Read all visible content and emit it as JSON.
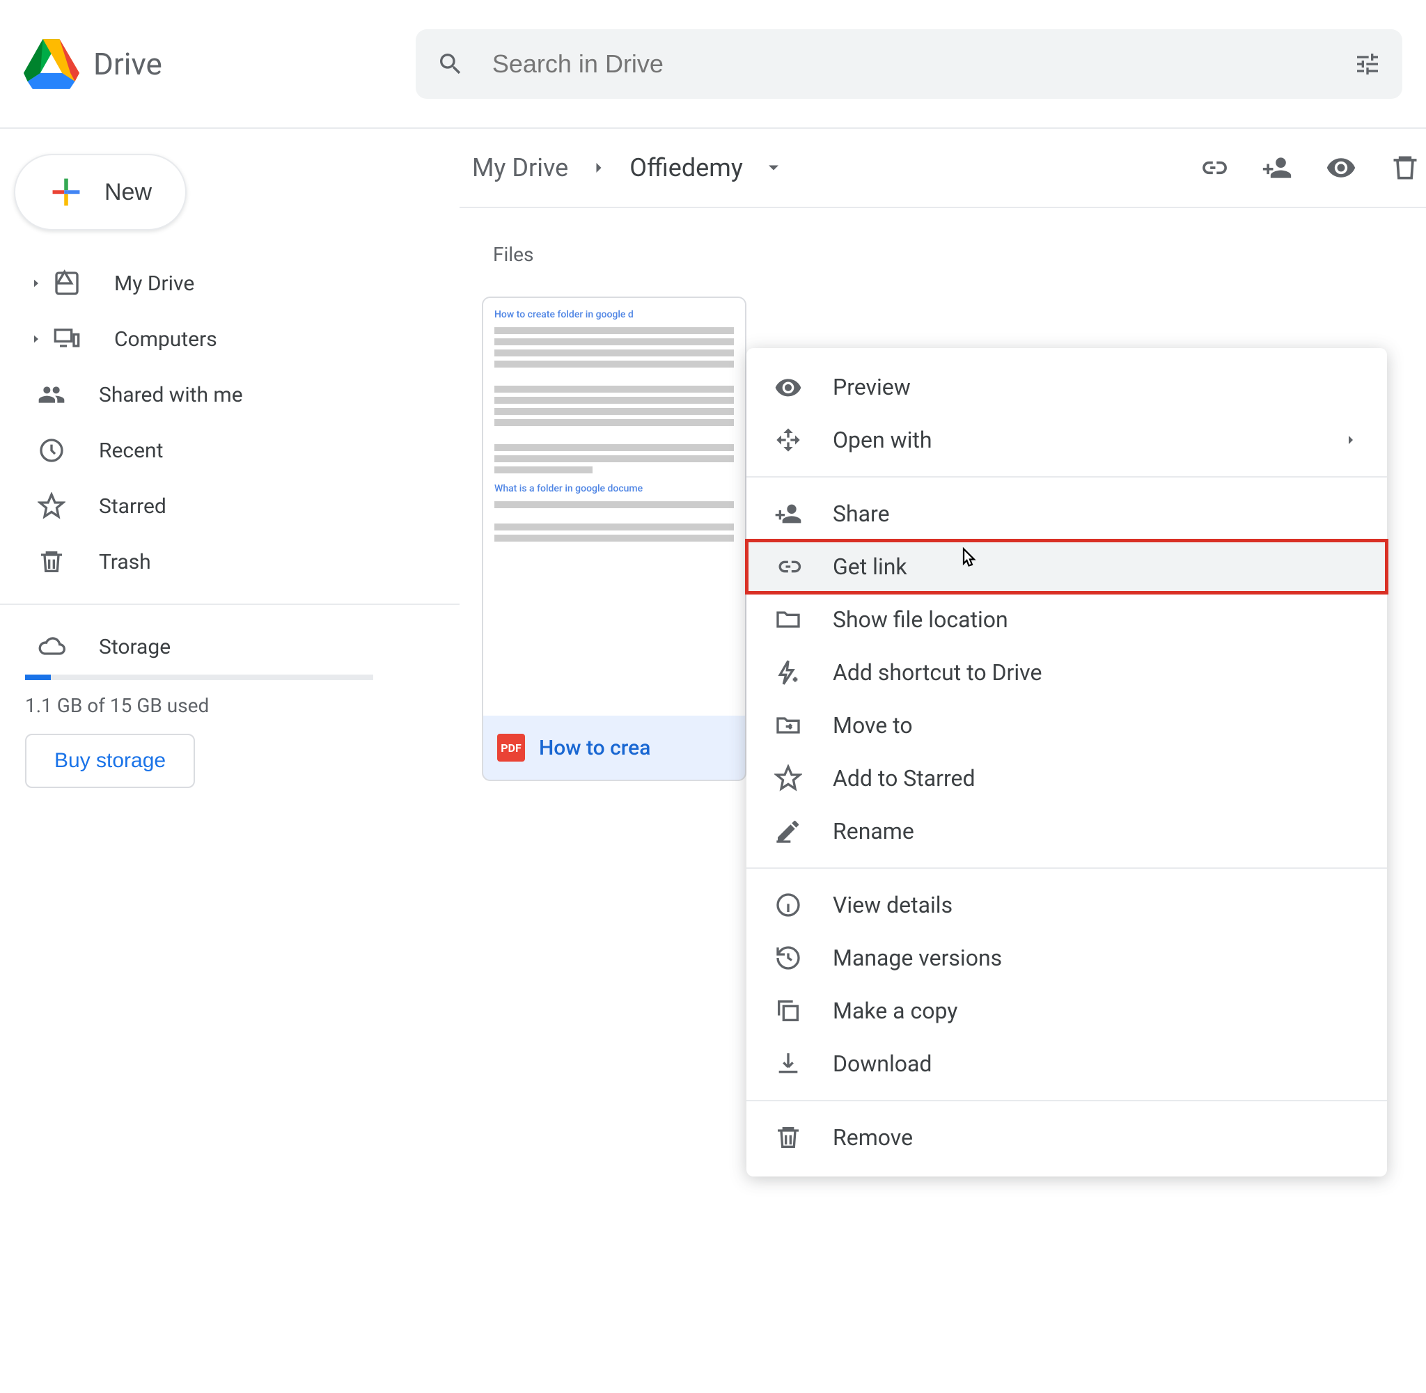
{
  "product": "Drive",
  "search": {
    "placeholder": "Search in Drive"
  },
  "new_btn": {
    "label": "New"
  },
  "sidebar": {
    "items": [
      {
        "label": "My Drive"
      },
      {
        "label": "Computers"
      },
      {
        "label": "Shared with me"
      },
      {
        "label": "Recent"
      },
      {
        "label": "Starred"
      },
      {
        "label": "Trash"
      }
    ],
    "storage_label": "Storage",
    "storage_text": "1.1 GB of 15 GB used",
    "buy_label": "Buy storage"
  },
  "breadcrumb": {
    "root": "My Drive",
    "current": "Offiedemy"
  },
  "files_header": "Files",
  "file": {
    "name": "How to crea",
    "badge": "PDF",
    "heading1": "How to create folder in google d",
    "heading2": "What is a folder in google docume"
  },
  "context_menu": {
    "group1": [
      {
        "label": "Preview"
      },
      {
        "label": "Open with",
        "submenu": true
      }
    ],
    "group2": [
      {
        "label": "Share"
      },
      {
        "label": "Get link",
        "highlight": true
      },
      {
        "label": "Show file location"
      },
      {
        "label": "Add shortcut to Drive"
      },
      {
        "label": "Move to"
      },
      {
        "label": "Add to Starred"
      },
      {
        "label": "Rename"
      }
    ],
    "group3": [
      {
        "label": "View details"
      },
      {
        "label": "Manage versions"
      },
      {
        "label": "Make a copy"
      },
      {
        "label": "Download"
      }
    ],
    "group4": [
      {
        "label": "Remove"
      }
    ]
  }
}
